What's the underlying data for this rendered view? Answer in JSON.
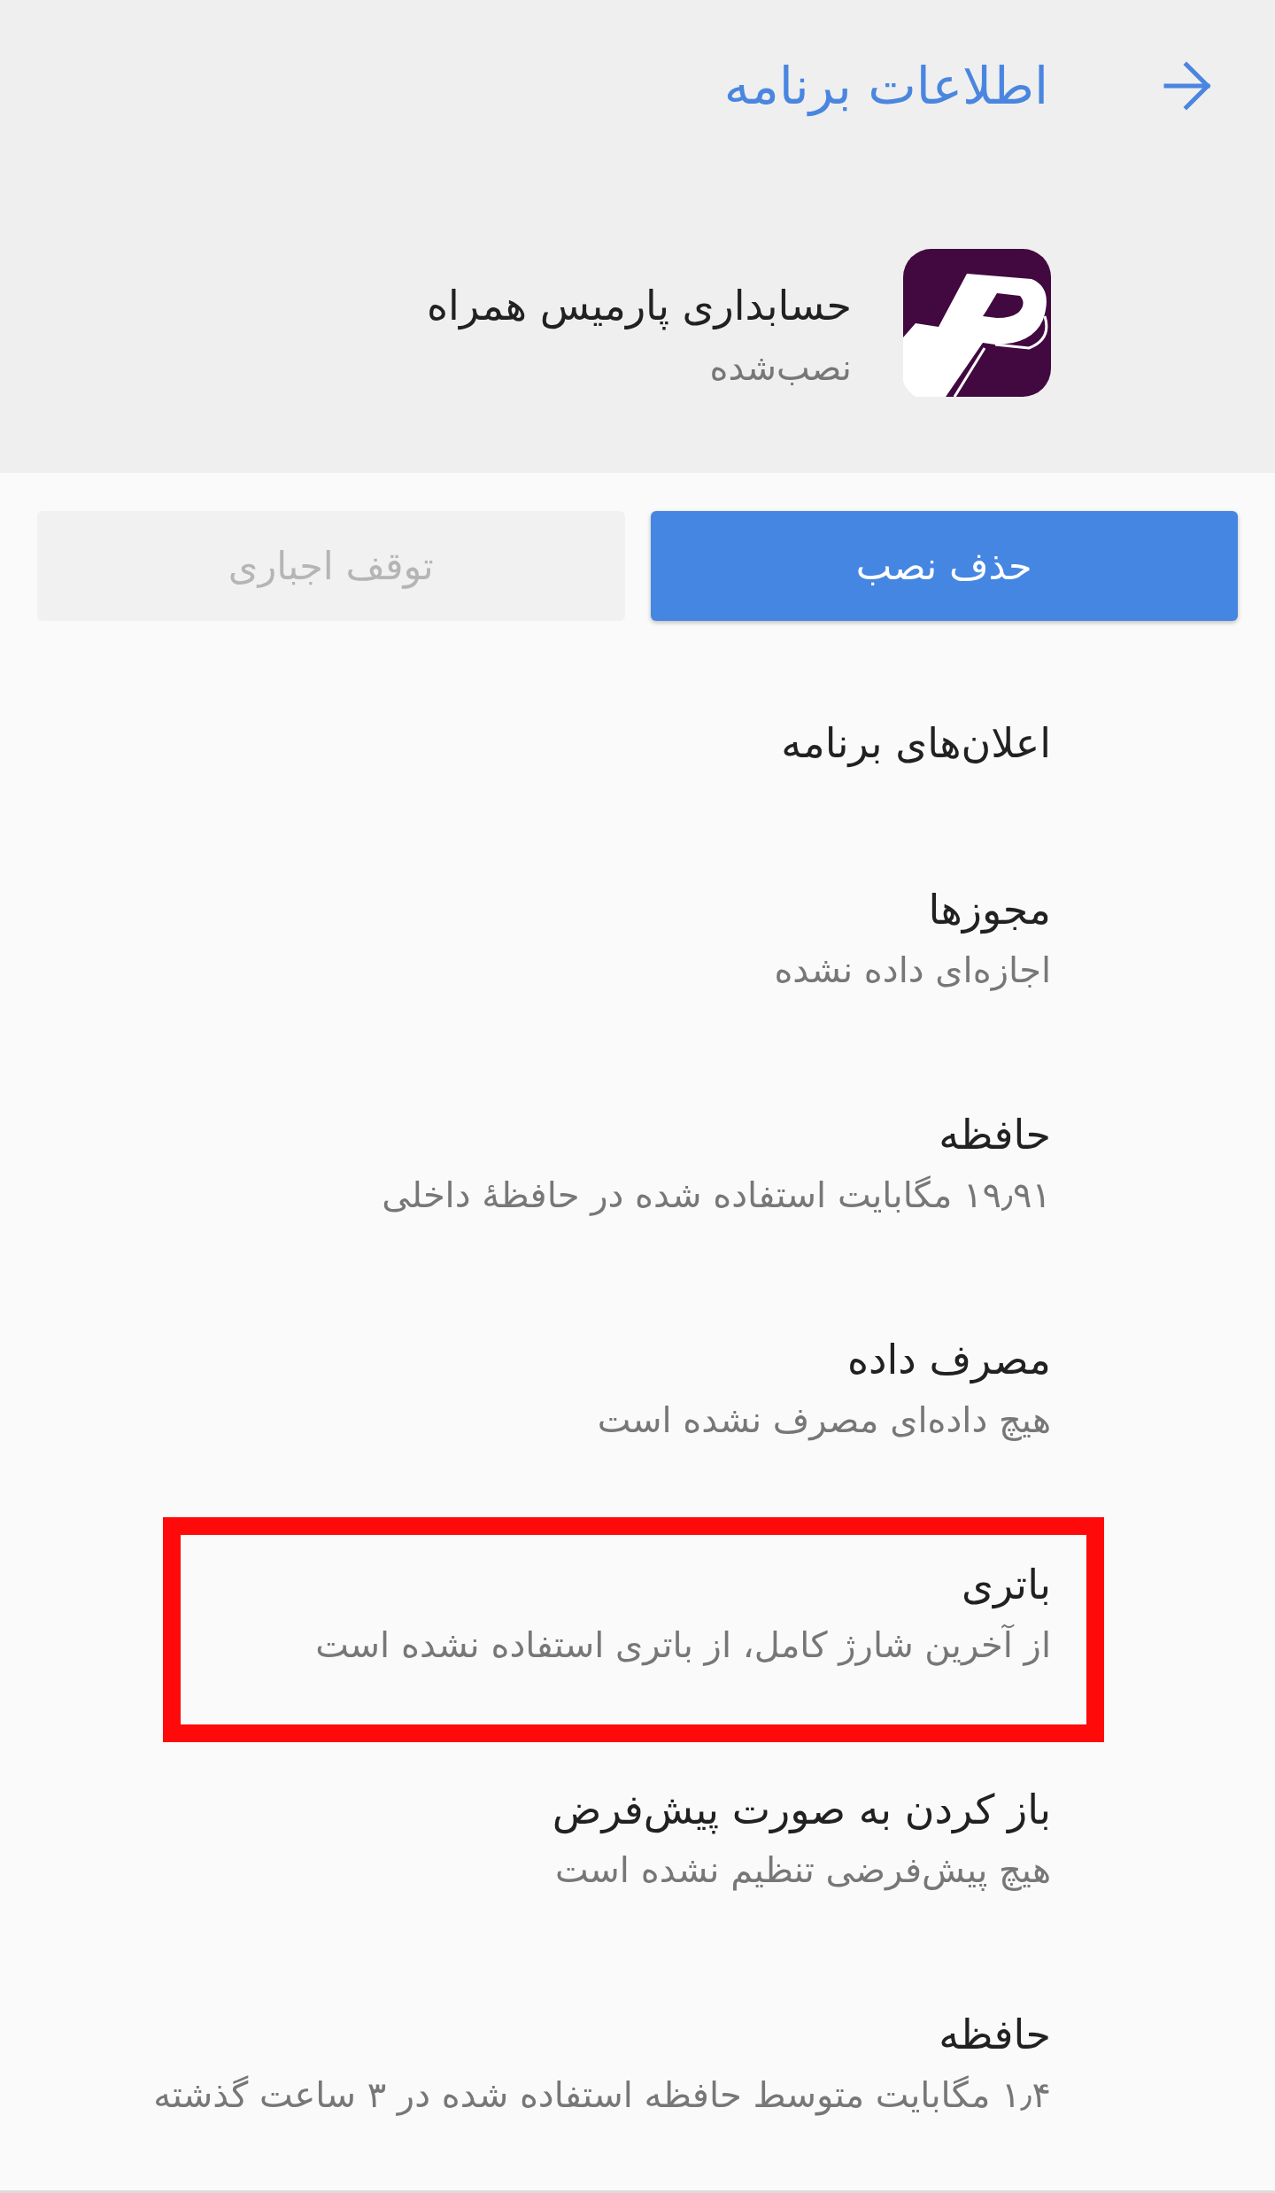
{
  "header": {
    "title": "اطلاعات برنامه"
  },
  "app": {
    "name": "حسابداری پارمیس همراه",
    "status": "نصب‌شده"
  },
  "buttons": [
    {
      "label": "حذف نصب",
      "disabled": false
    },
    {
      "label": "توقف اجباری",
      "disabled": true
    }
  ],
  "items": [
    {
      "title": "اعلان‌های برنامه",
      "highlighted": false
    },
    {
      "title": "مجوزها",
      "subtitle": "اجازه‌ای داده نشده",
      "highlighted": false
    },
    {
      "title": "حافظه",
      "subtitle": "۱۹٫۹۱ مگابایت استفاده شده در حافظهٔ داخلی",
      "highlighted": false
    },
    {
      "title": "مصرف داده",
      "subtitle": "هیچ داده‌ای مصرف نشده است",
      "highlighted": false
    },
    {
      "title": "باتری",
      "subtitle": "از آخرین شارژ کامل، از باتری استفاده نشده است",
      "highlighted": true
    },
    {
      "title": "باز کردن به صورت پیش‌فرض",
      "subtitle": "هیچ پیش‌فرضی تنظیم نشده است",
      "highlighted": false
    },
    {
      "title": "حافظه",
      "subtitle": "۱٫۴ مگابایت متوسط حافظه استفاده شده در ۳ ساعت گذشته",
      "highlighted": false
    }
  ]
}
